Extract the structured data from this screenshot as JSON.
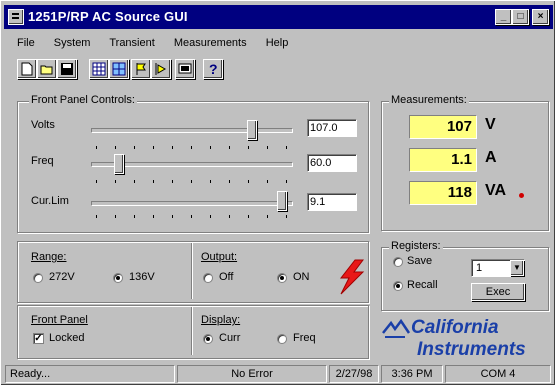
{
  "window": {
    "title": "1251P/RP AC Source GUI",
    "min": "_",
    "max": "□",
    "close": "×"
  },
  "menu": [
    "File",
    "System",
    "Transient",
    "Measurements",
    "Help"
  ],
  "toolbar": {
    "buttons": [
      "new-icon",
      "open-icon",
      "save-icon",
      "grid-icon",
      "table-icon",
      "flag-icon",
      "step-icon",
      "display-icon",
      "help-icon"
    ],
    "help_glyph": "?"
  },
  "front_panel": {
    "title": "Front Panel Controls:",
    "volts": {
      "label": "Volts",
      "value": "107.0",
      "level": 0.82
    },
    "freq": {
      "label": "Freq",
      "value": "60.0",
      "level": 0.12
    },
    "curlim": {
      "label": "Cur.Lim",
      "value": "9.1",
      "level": 0.98
    }
  },
  "measurements": {
    "title": "Measurements:",
    "voltage": {
      "value": "107",
      "unit": "V"
    },
    "current": {
      "value": "1.1",
      "unit": "A"
    },
    "power": {
      "value": "118",
      "unit": "VA"
    },
    "indicator_color": "#d00000"
  },
  "range": {
    "label": "Range:",
    "options": [
      "272V",
      "136V"
    ],
    "selected": "136V"
  },
  "output": {
    "label": "Output:",
    "options": [
      "Off",
      "ON"
    ],
    "selected": "ON"
  },
  "front_panel_lock": {
    "label": "Front Panel",
    "checkbox": "Locked",
    "checked": true
  },
  "display": {
    "label": "Display:",
    "options": [
      "Curr",
      "Freq"
    ],
    "selected": "Curr"
  },
  "registers": {
    "title": "Registers:",
    "save": "Save",
    "recall": "Recall",
    "selected": "Recall",
    "register_value": "1",
    "exec": "Exec"
  },
  "brand": {
    "line1": "California",
    "line2": "Instruments",
    "color": "#1a3fa8"
  },
  "status": {
    "ready": "Ready...",
    "error": "No Error",
    "date": "2/27/98",
    "time": "3:36 PM",
    "port": "COM 4"
  },
  "colors": {
    "title_bg": "#000080",
    "meas_bg": "#ffff80",
    "bolt": "#e81818"
  }
}
